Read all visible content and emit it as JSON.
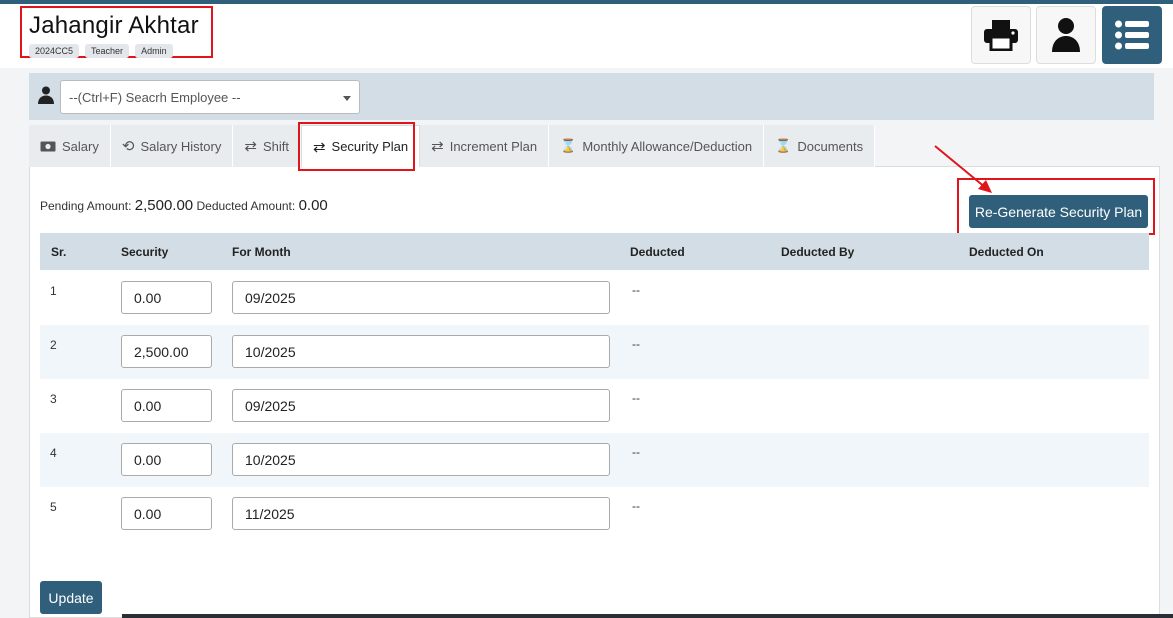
{
  "employee": {
    "name": "Jahangir Akhtar",
    "badges": [
      "2024CC5",
      "Teacher",
      "Admin"
    ]
  },
  "header_buttons": [
    "printer-icon",
    "user-icon",
    "list-menu-icon"
  ],
  "search": {
    "placeholder": "--(Ctrl+F) Seacrh Employee --"
  },
  "tabs": [
    {
      "label": "Salary",
      "icon": "money-icon"
    },
    {
      "label": "Salary History",
      "icon": "history-icon"
    },
    {
      "label": "Shift",
      "icon": "exchange-icon"
    },
    {
      "label": "Security Plan",
      "icon": "exchange-icon",
      "active": true
    },
    {
      "label": "Increment Plan",
      "icon": "exchange-icon"
    },
    {
      "label": "Monthly Allowance/Deduction",
      "icon": "hourglass-icon"
    },
    {
      "label": "Documents",
      "icon": "hourglass-icon"
    }
  ],
  "summary": {
    "pending_label": "Pending Amount:",
    "pending_value": "2,500.00",
    "deducted_label": "Deducted Amount:",
    "deducted_value": "0.00"
  },
  "regenerate_label": "Re-Generate Security Plan",
  "table": {
    "headers": [
      "Sr.",
      "Security",
      "For Month",
      "Deducted",
      "Deducted By",
      "Deducted On"
    ],
    "rows": [
      {
        "sr": "1",
        "security": "0.00",
        "month": "09/2025",
        "deducted": "--"
      },
      {
        "sr": "2",
        "security": "2,500.00",
        "month": "10/2025",
        "deducted": "--"
      },
      {
        "sr": "3",
        "security": "0.00",
        "month": "09/2025",
        "deducted": "--"
      },
      {
        "sr": "4",
        "security": "0.00",
        "month": "10/2025",
        "deducted": "--"
      },
      {
        "sr": "5",
        "security": "0.00",
        "month": "11/2025",
        "deducted": "--"
      }
    ]
  },
  "update_label": "Update",
  "colors": {
    "primary": "#2f5f7a",
    "highlight": "#e0141b",
    "table_header": "#d2dde5"
  }
}
